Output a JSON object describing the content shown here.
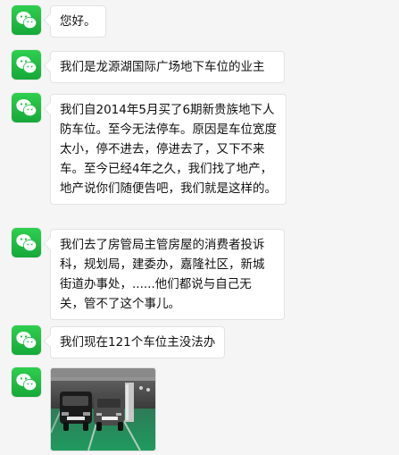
{
  "app": {
    "name": "WeChat"
  },
  "messages": [
    {
      "sender_avatar": "wechat-logo-icon",
      "text": "您好。"
    },
    {
      "sender_avatar": "wechat-logo-icon",
      "text": "我们是龙源湖国际广场地下车位的业主"
    },
    {
      "sender_avatar": "wechat-logo-icon",
      "text": "我们自2014年5月买了6期新贵族地下人防车位。至今无法停车。原因是车位宽度太小，停不进去，停进去了，又下不来车。至今已经4年之久，我们找了地产，地产说你们随便告吧，我们就是这样的。"
    },
    {
      "sender_avatar": "wechat-logo-icon",
      "text": "我们去了房管局主管房屋的消费者投诉科，规划局，建委办，嘉隆社区，新城街道办事处，......他们都说与自己无关，管不了这个事儿。"
    },
    {
      "sender_avatar": "wechat-logo-icon",
      "text": "我们现在121个车位主没法办"
    },
    {
      "sender_avatar": "wechat-logo-icon",
      "image": "parking-garage-photo"
    }
  ],
  "colors": {
    "background": "#f5f5f5",
    "bubble": "#ffffff",
    "bubble_border": "#e3e3e3",
    "avatar_green": "#1fbf45",
    "text": "#111111"
  }
}
